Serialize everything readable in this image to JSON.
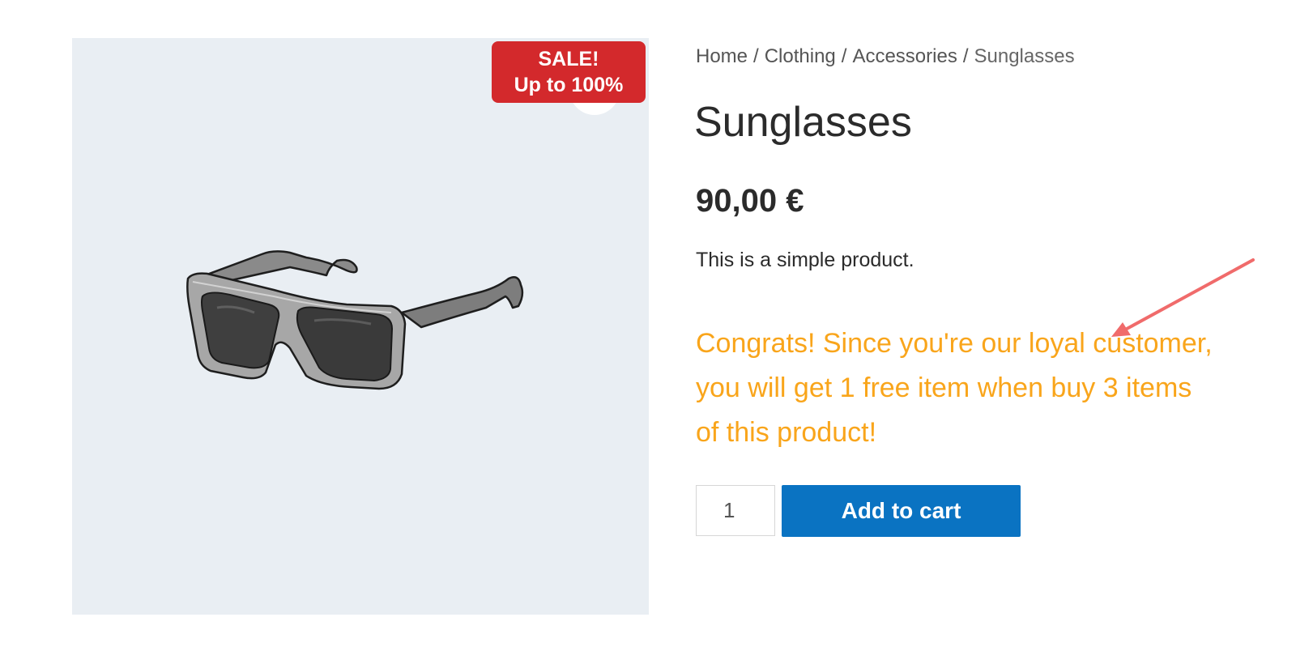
{
  "gallery": {
    "sale_badge": {
      "line1": "SALE!",
      "line2": "Up to 100%"
    },
    "image_icon": "sunglasses-illustration"
  },
  "breadcrumb": [
    "Home",
    "Clothing",
    "Accessories",
    "Sunglasses"
  ],
  "product": {
    "title": "Sunglasses",
    "price": "90,00 €",
    "short_description": "This is a simple product.",
    "loyalty_message": "Congrats! Since you're our loyal customer, you will get 1 free item when buy 3 items of this product!"
  },
  "cart": {
    "quantity": "1",
    "add_to_cart_label": "Add to cart"
  },
  "colors": {
    "sale_badge": "#d3292c",
    "gallery_background": "#e9eef3",
    "loyalty_message": "#f9a51b",
    "add_to_cart_button": "#0a73c2",
    "annotation_arrow": "#f06b6b"
  }
}
